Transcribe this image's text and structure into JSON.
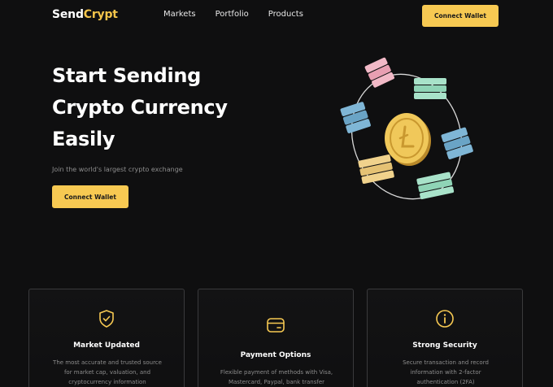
{
  "brand": {
    "part1": "Send",
    "part2": "Crypt"
  },
  "nav": {
    "items": [
      "Markets",
      "Portfolio",
      "Products"
    ],
    "connect_label": "Connect Wallet"
  },
  "hero": {
    "title_lines": [
      "Start Sending",
      "Crypto Currency",
      "Easily"
    ],
    "subtitle": "Join the world's largest crypto exchange",
    "button_label": "Connect Wallet",
    "illustration": "crypto-coin-orbit-illustration"
  },
  "features": [
    {
      "icon": "shield-check-icon",
      "title": "Market Updated",
      "description_lines": [
        "The most accurate and trusted source",
        "for market cap, valuation, and",
        "cryptocurrency information"
      ]
    },
    {
      "icon": "wallet-card-icon",
      "title": "Payment Options",
      "description_lines": [
        "Flexible payment of methods with Visa,",
        "Mastercard, Paypal, bank transfer"
      ]
    },
    {
      "icon": "info-circle-icon",
      "title": "Strong Security",
      "description_lines": [
        "Secure transaction and record",
        "information with 2-factor",
        "authentication (2FA)"
      ]
    }
  ],
  "colors": {
    "background": "#0f0f10",
    "accent": "#f7c952",
    "muted_text": "#8d8d8d"
  }
}
